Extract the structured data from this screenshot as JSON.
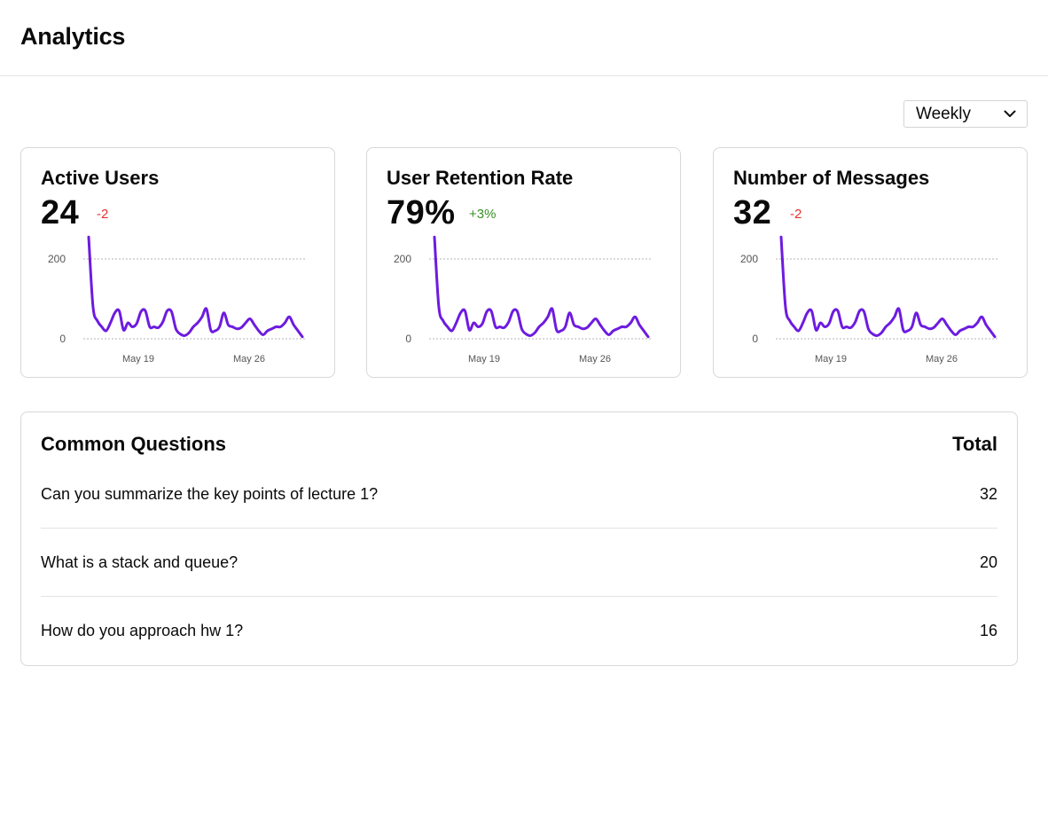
{
  "header": {
    "title": "Analytics"
  },
  "period": {
    "selected": "Weekly"
  },
  "colors": {
    "accent": "#6d1be0",
    "negative": "#e5322d",
    "positive": "#3a8f25"
  },
  "cards": [
    {
      "title": "Active Users",
      "value": "24",
      "delta": "-2",
      "delta_kind": "negative",
      "chart": {
        "y_ticks": [
          "200",
          "0"
        ],
        "x_ticks": [
          "May 19",
          "May 26"
        ]
      }
    },
    {
      "title": "User Retention Rate",
      "value": "79%",
      "delta": "+3%",
      "delta_kind": "positive",
      "chart": {
        "y_ticks": [
          "200",
          "0"
        ],
        "x_ticks": [
          "May 19",
          "May 26"
        ]
      }
    },
    {
      "title": "Number of Messages",
      "value": "32",
      "delta": "-2",
      "delta_kind": "negative",
      "chart": {
        "y_ticks": [
          "200",
          "0"
        ],
        "x_ticks": [
          "May 19",
          "May 26"
        ]
      }
    }
  ],
  "chart_data": {
    "type": "line",
    "x_start": "May 13",
    "x_end": "May 31",
    "x_ticks": [
      "May 19",
      "May 26"
    ],
    "ylim": [
      0,
      200
    ],
    "y_ticks": [
      0,
      200
    ],
    "grid": true,
    "series": [
      {
        "values": [
          255,
          80,
          45,
          30,
          20,
          40,
          65,
          70,
          22,
          40,
          30,
          38,
          68,
          70,
          30,
          30,
          28,
          42,
          70,
          68,
          25,
          12,
          8,
          15,
          30,
          40,
          55,
          75,
          22,
          20,
          30,
          65,
          35,
          30,
          25,
          28,
          40,
          50,
          35,
          20,
          10,
          20,
          25,
          30,
          30,
          40,
          55,
          35,
          20,
          5
        ]
      }
    ]
  },
  "questions": {
    "title": "Common Questions",
    "total_label": "Total",
    "rows": [
      {
        "question": "Can you summarize the key points of lecture 1?",
        "total": "32"
      },
      {
        "question": "What is a stack and queue?",
        "total": "20"
      },
      {
        "question": "How do you approach hw 1?",
        "total": "16"
      }
    ]
  }
}
